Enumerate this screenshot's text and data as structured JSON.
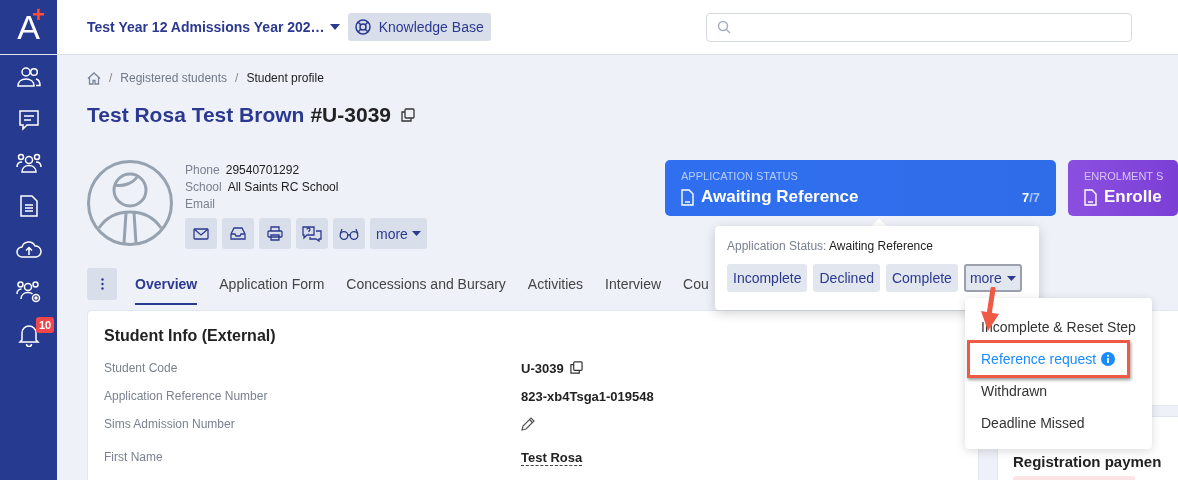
{
  "logo": {
    "letter": "A",
    "mark": "+"
  },
  "sidebar": {
    "items": [
      {
        "kind": "people",
        "selected": false
      },
      {
        "kind": "chat",
        "selected": false
      },
      {
        "kind": "group",
        "selected": false
      },
      {
        "kind": "document",
        "selected": false
      },
      {
        "kind": "upload",
        "selected": false
      },
      {
        "kind": "group-settings",
        "selected": false
      },
      {
        "kind": "bell",
        "selected": false,
        "badge": "10"
      }
    ]
  },
  "topbar": {
    "program": "Test Year 12 Admissions Year 202…",
    "help_button": "Knowledge Base"
  },
  "breadcrumb": {
    "separator": "/",
    "items": [
      "Registered students",
      "Student profile"
    ]
  },
  "title": {
    "name": "Test Rosa Test Brown",
    "code": "#U-3039"
  },
  "contact": [
    {
      "label": "Phone",
      "value": "29540701292"
    },
    {
      "label": "School",
      "value": "All Saints RC School"
    },
    {
      "label": "Email"
    }
  ],
  "actions": [
    {
      "kind": "email"
    },
    {
      "kind": "inbox"
    },
    {
      "kind": "print"
    },
    {
      "kind": "question-chat"
    },
    {
      "kind": "glasses"
    },
    {
      "kind": "more",
      "label": "more"
    }
  ],
  "tabs": [
    {
      "label": "Overview",
      "selected": true
    },
    {
      "label": "Application Form",
      "selected": false
    },
    {
      "label": "Concessions and Bursary",
      "selected": false
    },
    {
      "label": "Activities",
      "selected": false
    },
    {
      "label": "Interview",
      "selected": false
    },
    {
      "label": "Cou",
      "selected": false
    }
  ],
  "status_cards": [
    {
      "kind": "application",
      "label": "APPLICATION STATUS",
      "value": "Awaiting Reference",
      "step": "7",
      "total": "/7"
    },
    {
      "kind": "enrolment",
      "label": "ENROLMENT S",
      "value": "Enrolle"
    }
  ],
  "status_popover": {
    "label": "Application Status:",
    "value": "Awaiting Reference",
    "buttons": [
      {
        "label": "Incomplete",
        "open": false
      },
      {
        "label": "Declined",
        "open": false
      },
      {
        "label": "Complete",
        "open": false
      },
      {
        "label": "more",
        "open": true,
        "kind": "menu"
      }
    ]
  },
  "status_menu": [
    {
      "label": "Incomplete & Reset Step",
      "selected": false
    },
    {
      "label": "Reference request",
      "selected": true
    },
    {
      "label": "Withdrawn",
      "selected": false
    },
    {
      "label": "Deadline Missed",
      "selected": false
    }
  ],
  "student_info": {
    "title": "Student Info (External)",
    "fields": [
      {
        "label": "Student Code",
        "value": "U-3039",
        "kind": "copy"
      },
      {
        "label": "Application Reference Number",
        "value": "823-xb4Tsga1-019548",
        "kind": "text"
      },
      {
        "label": "Sims Admission Number",
        "kind": "edit"
      },
      {
        "label": "First Name",
        "value": "Test Rosa",
        "kind": "editable"
      }
    ]
  },
  "side_card": {
    "title": "Registration paymen"
  }
}
